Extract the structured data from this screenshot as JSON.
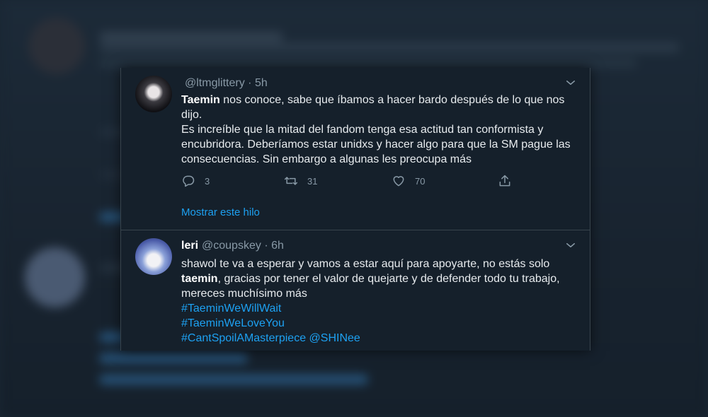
{
  "tweets": [
    {
      "name": "",
      "handle": "@ltmglittery",
      "time": "5h",
      "paragraphs": [
        {
          "bold": "Taemin",
          "text": " nos conoce, sabe que íbamos a hacer bardo después de lo que nos dijo."
        },
        {
          "bold": "",
          "text": "Es increíble que la mitad del fandom tenga esa actitud tan conformista y encubridora. Deberíamos estar unidxs y hacer algo para que la SM pague las consecuencias. Sin embargo a algunas les preocupa más"
        }
      ],
      "counts": {
        "replies": "3",
        "retweets": "31",
        "likes": "70"
      },
      "show_thread": "Mostrar este hilo",
      "icons": [
        "reply-icon",
        "retweet-icon",
        "like-icon",
        "share-icon",
        "chevron-down-icon"
      ]
    },
    {
      "name": "leri",
      "handle": "@coupskey",
      "time": "6h",
      "line1": "shawol te va a esperar y vamos a estar aquí para apoyarte, no estás solo",
      "bold": "taemin",
      "line2": ", gracias por tener el valor de quejarte y de defender todo tu trabajo, mereces muchísimo más",
      "hashtags": [
        "#TaeminWeWillWait",
        "#TaeminWeLoveYou"
      ],
      "hashtag3": "#CantSpoilAMasterpiece",
      "mention": "@SHINee"
    }
  ],
  "colors": {
    "background": "#15202b",
    "text": "#e7ebee",
    "muted": "#8899a6",
    "link": "#1da1f2",
    "border": "#38444d"
  }
}
